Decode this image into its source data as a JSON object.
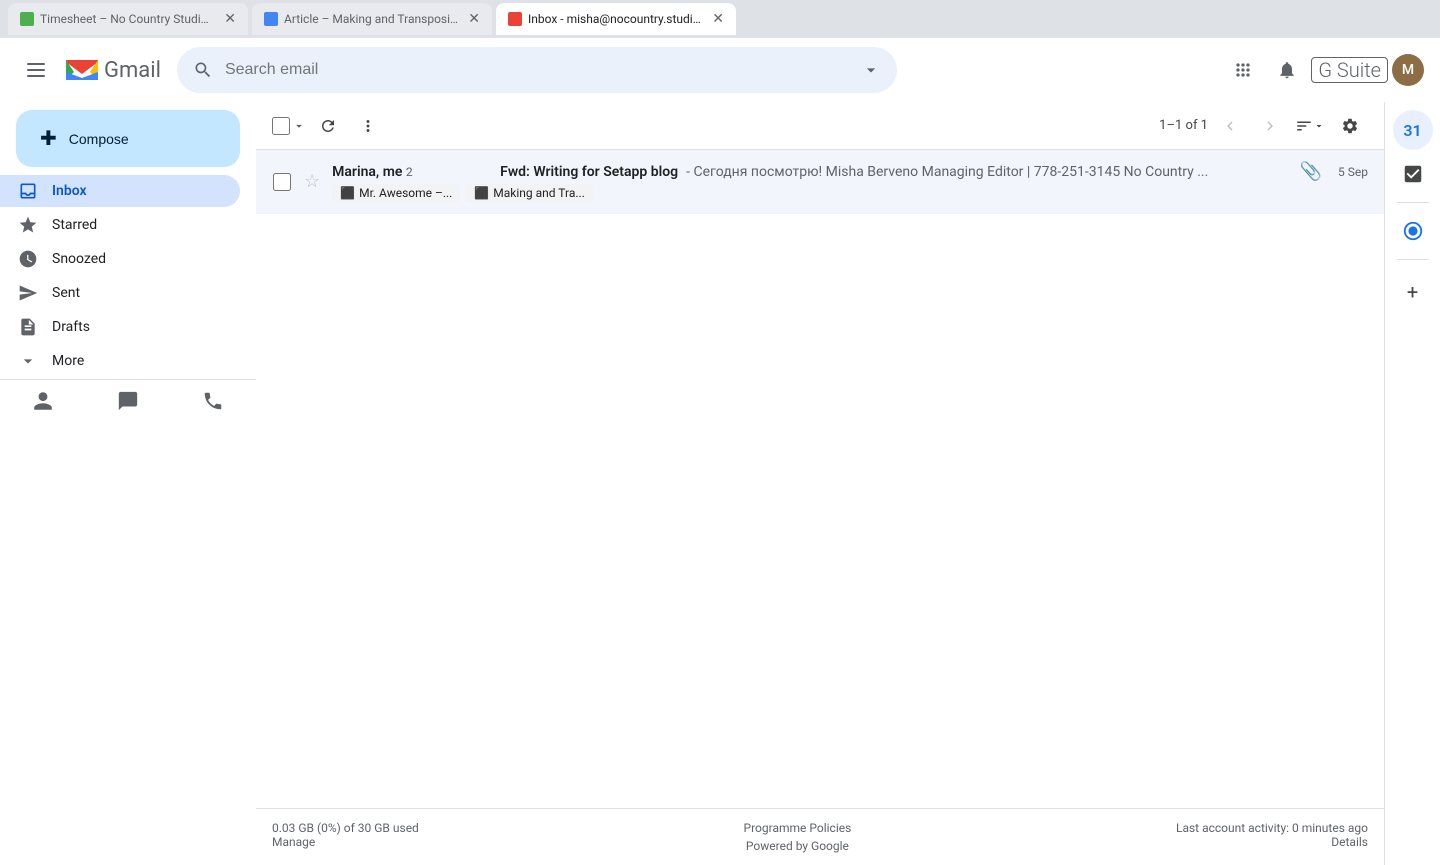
{
  "browser": {
    "tabs": [
      {
        "id": "tab-harvest",
        "label": "Timesheet – No Country Studio – Harvest",
        "favicon_color": "#4caf50",
        "active": false
      },
      {
        "id": "tab-docs",
        "label": "Article – Making and Transposing an Email Signature – Google Docs",
        "favicon_color": "#4285f4",
        "active": false
      },
      {
        "id": "tab-gmail",
        "label": "Inbox - misha@nocountry.studio - No Country Mail",
        "favicon_color": "#ea4335",
        "active": true
      }
    ]
  },
  "header": {
    "search_placeholder": "Search email",
    "gsuite_label": "G Suite"
  },
  "compose": {
    "label": "Compose",
    "plus_icon": "+"
  },
  "nav": {
    "items": [
      {
        "id": "inbox",
        "label": "Inbox",
        "icon": "📥",
        "active": true
      },
      {
        "id": "starred",
        "label": "Starred",
        "icon": "⭐",
        "active": false
      },
      {
        "id": "snoozed",
        "label": "Snoozed",
        "icon": "🕐",
        "active": false
      },
      {
        "id": "sent",
        "label": "Sent",
        "icon": "▶",
        "active": false
      },
      {
        "id": "drafts",
        "label": "Drafts",
        "icon": "📄",
        "active": false
      },
      {
        "id": "more",
        "label": "More",
        "icon": "∨",
        "active": false
      }
    ]
  },
  "toolbar": {
    "page_count": "1–1 of 1",
    "select_all_label": "Select",
    "refresh_label": "Refresh",
    "more_label": "More"
  },
  "emails": [
    {
      "id": "email-1",
      "sender": "Marina, me",
      "sender_count": "2",
      "subject": "Fwd: Writing for Setapp blog",
      "snippet": "- Сегодня посмотрю! Misha Berveno Managing Editor | 778-251-3145 No Country ...",
      "date": "5 Sep",
      "has_attachment": true,
      "starred": false,
      "chips": [
        {
          "id": "chip-1",
          "icon": "📊",
          "label": "Mr. Awesome –..."
        },
        {
          "id": "chip-2",
          "icon": "📄",
          "label": "Making and Tra..."
        }
      ]
    }
  ],
  "footer": {
    "storage": "0.03 GB (0%) of 30 GB used",
    "manage_label": "Manage",
    "policy_label": "Programme Policies",
    "powered_label": "Powered by Google",
    "activity_label": "Last account activity: 0 minutes ago",
    "details_label": "Details"
  },
  "right_sidebar": {
    "icons": [
      {
        "id": "calendar",
        "glyph": "31",
        "active": false
      },
      {
        "id": "tasks",
        "glyph": "✓",
        "active": false
      },
      {
        "id": "circle-check",
        "glyph": "◎",
        "active": true
      }
    ]
  },
  "sidebar_bottom": {
    "icons": [
      {
        "id": "person",
        "glyph": "👤"
      },
      {
        "id": "chat",
        "glyph": "💬"
      },
      {
        "id": "phone",
        "glyph": "📞"
      }
    ]
  }
}
